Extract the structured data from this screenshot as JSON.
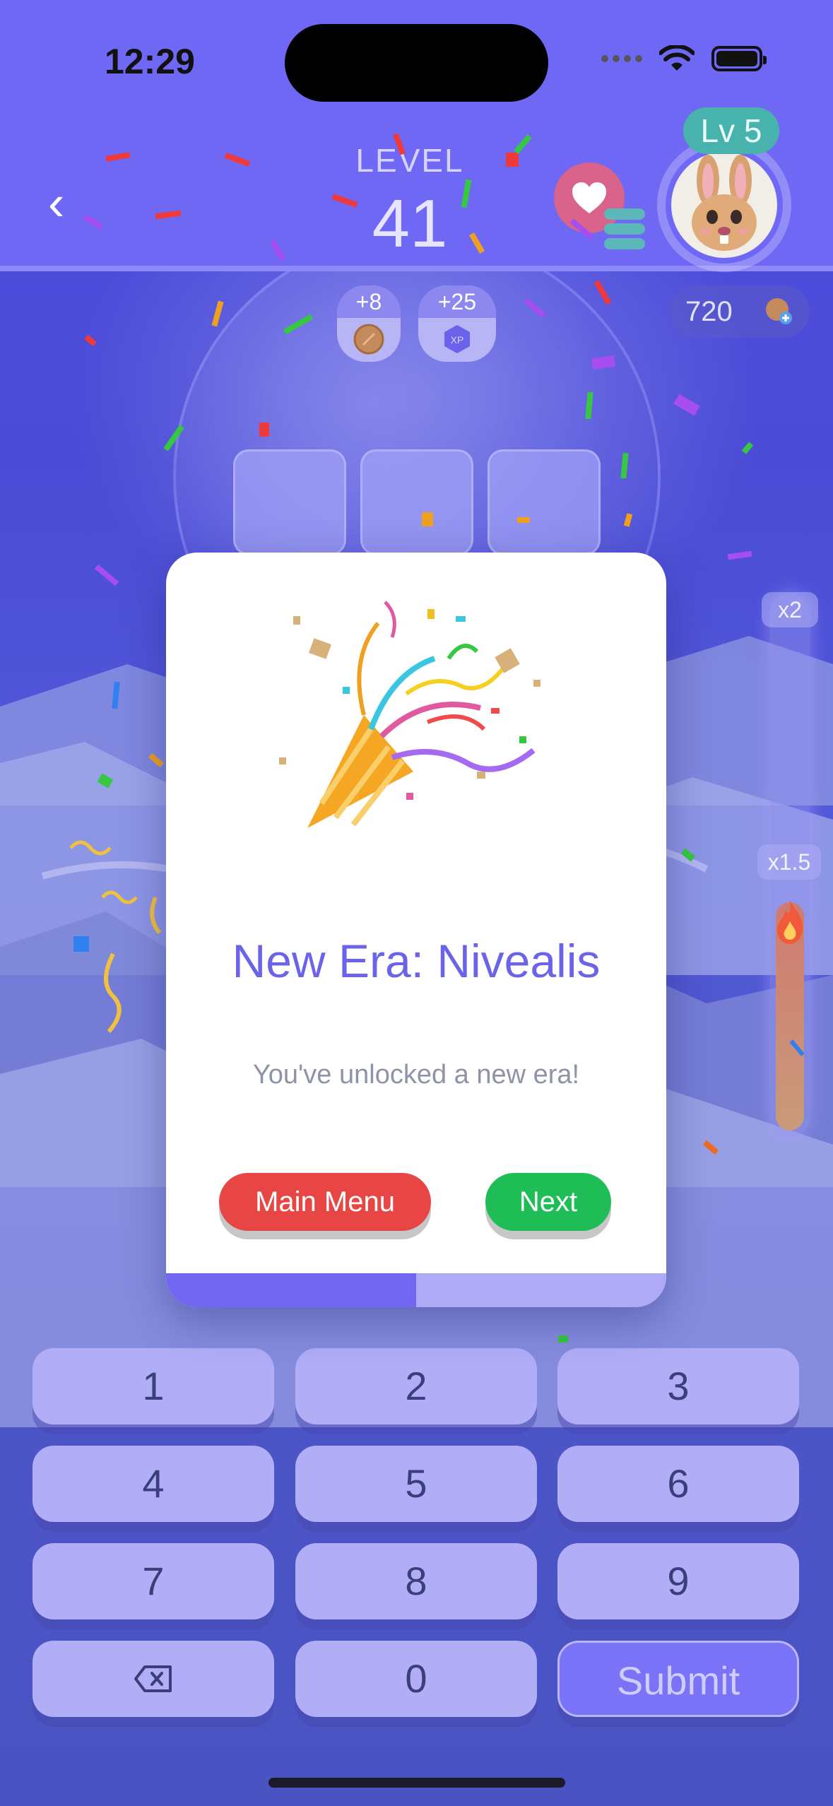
{
  "status_bar": {
    "time": "12:29"
  },
  "header": {
    "back_glyph": "‹",
    "level_label": "LEVEL",
    "level_number": "41",
    "player_level": "Lv 5"
  },
  "rewards": {
    "coins": "+8",
    "xp": "+25",
    "xp_icon_text": "XP"
  },
  "wallet": {
    "coins": "720"
  },
  "multiplier": {
    "top": "x2",
    "current": "x1.5",
    "fill_fraction": 0.42
  },
  "modal": {
    "title": "New Era:  Nivealis",
    "subtitle": "You've unlocked a new era!",
    "main_menu_label": "Main Menu",
    "next_label": "Next",
    "progress_fraction": 0.5
  },
  "keypad": {
    "keys": [
      "1",
      "2",
      "3",
      "4",
      "5",
      "6",
      "7",
      "8",
      "9"
    ],
    "zero": "0",
    "submit": "Submit",
    "backspace_icon": "backspace-icon"
  },
  "colors": {
    "header_bg": "#6f68f5",
    "accent": "#6b63e8",
    "danger": "#e84545",
    "success": "#1fbd55"
  }
}
